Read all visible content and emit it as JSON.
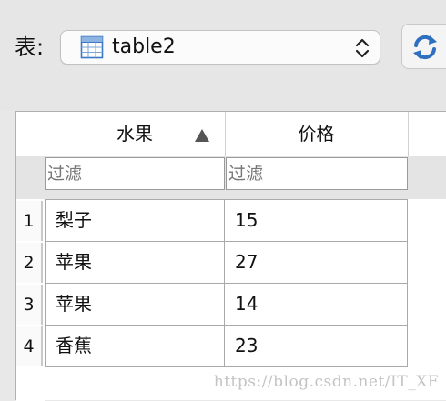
{
  "toolbar": {
    "table_label": "表:",
    "table_select_value": "table2",
    "icons": {
      "table": "table-icon",
      "chevrons": "up-down-chevron-icon",
      "refresh": "refresh-icon"
    },
    "accent_color": "#3a78c7"
  },
  "grid": {
    "columns": [
      {
        "label": "水果",
        "sorted": "ascending"
      },
      {
        "label": "价格"
      }
    ],
    "filter_placeholders": [
      "过滤",
      "过滤"
    ],
    "rows": [
      {
        "num": "1",
        "fruit": "梨子",
        "price": "15"
      },
      {
        "num": "2",
        "fruit": "苹果",
        "price": "27"
      },
      {
        "num": "3",
        "fruit": "苹果",
        "price": "14"
      },
      {
        "num": "4",
        "fruit": "香蕉",
        "price": "23"
      }
    ]
  },
  "watermark": "https://blog.csdn.net/IT_XF"
}
